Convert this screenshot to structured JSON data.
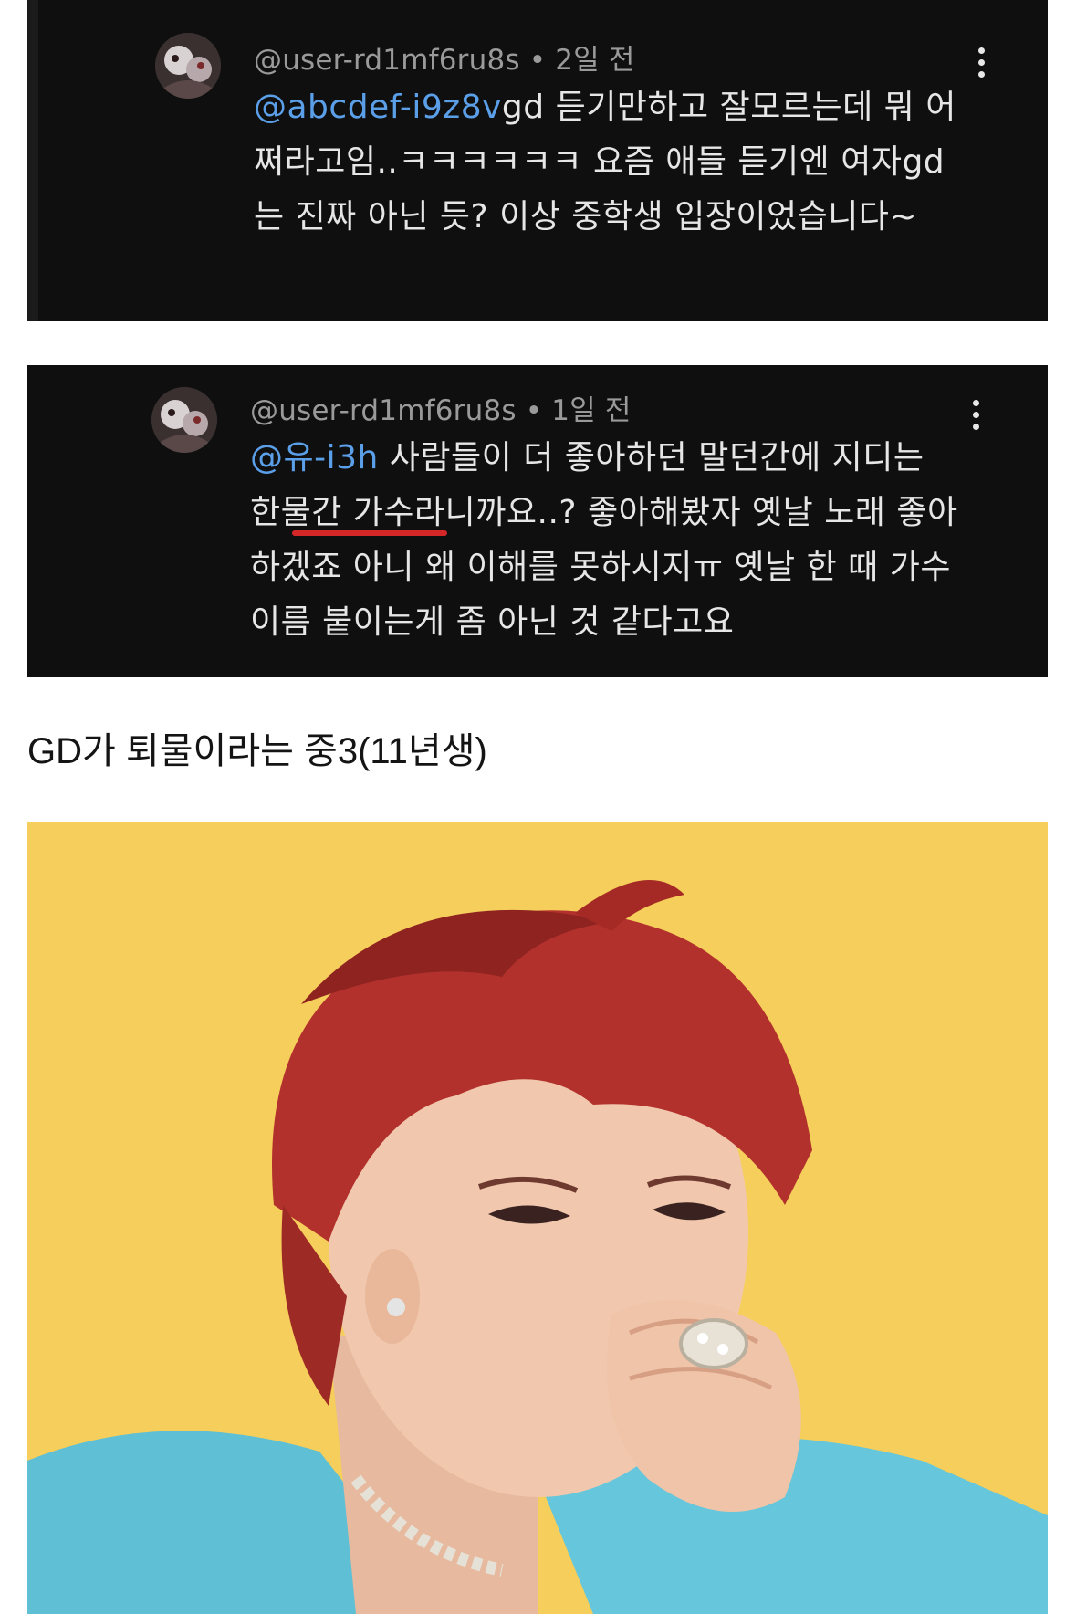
{
  "comments": [
    {
      "username": "@user-rd1mf6ru8s",
      "separator": "•",
      "time": "2일 전",
      "mention": "@abcdef-i9z8v",
      "text": "gd 듣기만하고 잘모르는데 뭐 어쩌라고임..ㅋㅋㅋㅋㅋㅋ 요즘 애들 듣기엔 여자gd는 진짜 아닌 듯? 이상 중학생 입장이었습니다~"
    },
    {
      "username": "@user-rd1mf6ru8s",
      "separator": "•",
      "time": "1일 전",
      "mention": "@유-i3h",
      "text": "사람들이 더 좋아하던 말던간에 지디는 한물간 가수라니까요..? 좋아해봤자 옛날 노래 좋아하겠죠 아니 왜 이해를 못하시지ㅠ 옛날 한 때 가수 이름 붙이는게 좀 아닌 것 같다고요"
    }
  ],
  "caption": "GD가 퇴물이라는 중3(11년생)",
  "colors": {
    "card_bg": "#0f0f0f",
    "mention": "#5a9fe8",
    "underline": "#d52727",
    "photo_bg": "#f6d262"
  }
}
